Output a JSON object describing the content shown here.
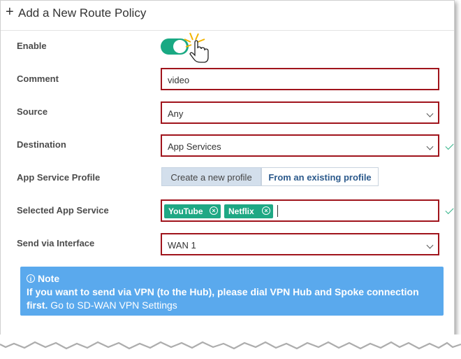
{
  "header": {
    "plus_icon": "plus-icon",
    "title": "Add a New Route Policy"
  },
  "form": {
    "enable": {
      "label": "Enable",
      "state": true
    },
    "comment": {
      "label": "Comment",
      "value": "video"
    },
    "source": {
      "label": "Source",
      "value": "Any"
    },
    "destination": {
      "label": "Destination",
      "value": "App Services"
    },
    "app_service_profile": {
      "label": "App Service Profile",
      "options": [
        "Create a new profile",
        "From an existing profile"
      ],
      "selected": "Create a new profile"
    },
    "selected_app_service": {
      "label": "Selected App Service",
      "tags": [
        "YouTube",
        "Netflix"
      ]
    },
    "send_via_interface": {
      "label": "Send via Interface",
      "value": "WAN 1"
    }
  },
  "note": {
    "title": "Note",
    "text": "If you want to send via VPN (to the Hub), please dial VPN Hub and Spoke connection first.",
    "link": "Go to SD-WAN VPN Settings"
  },
  "colors": {
    "toggle_on": "#19a983",
    "field_border_error": "#a0141c",
    "tag_bg": "#1fa884",
    "note_bg": "#5aa9ed",
    "check": "#35b48a"
  }
}
